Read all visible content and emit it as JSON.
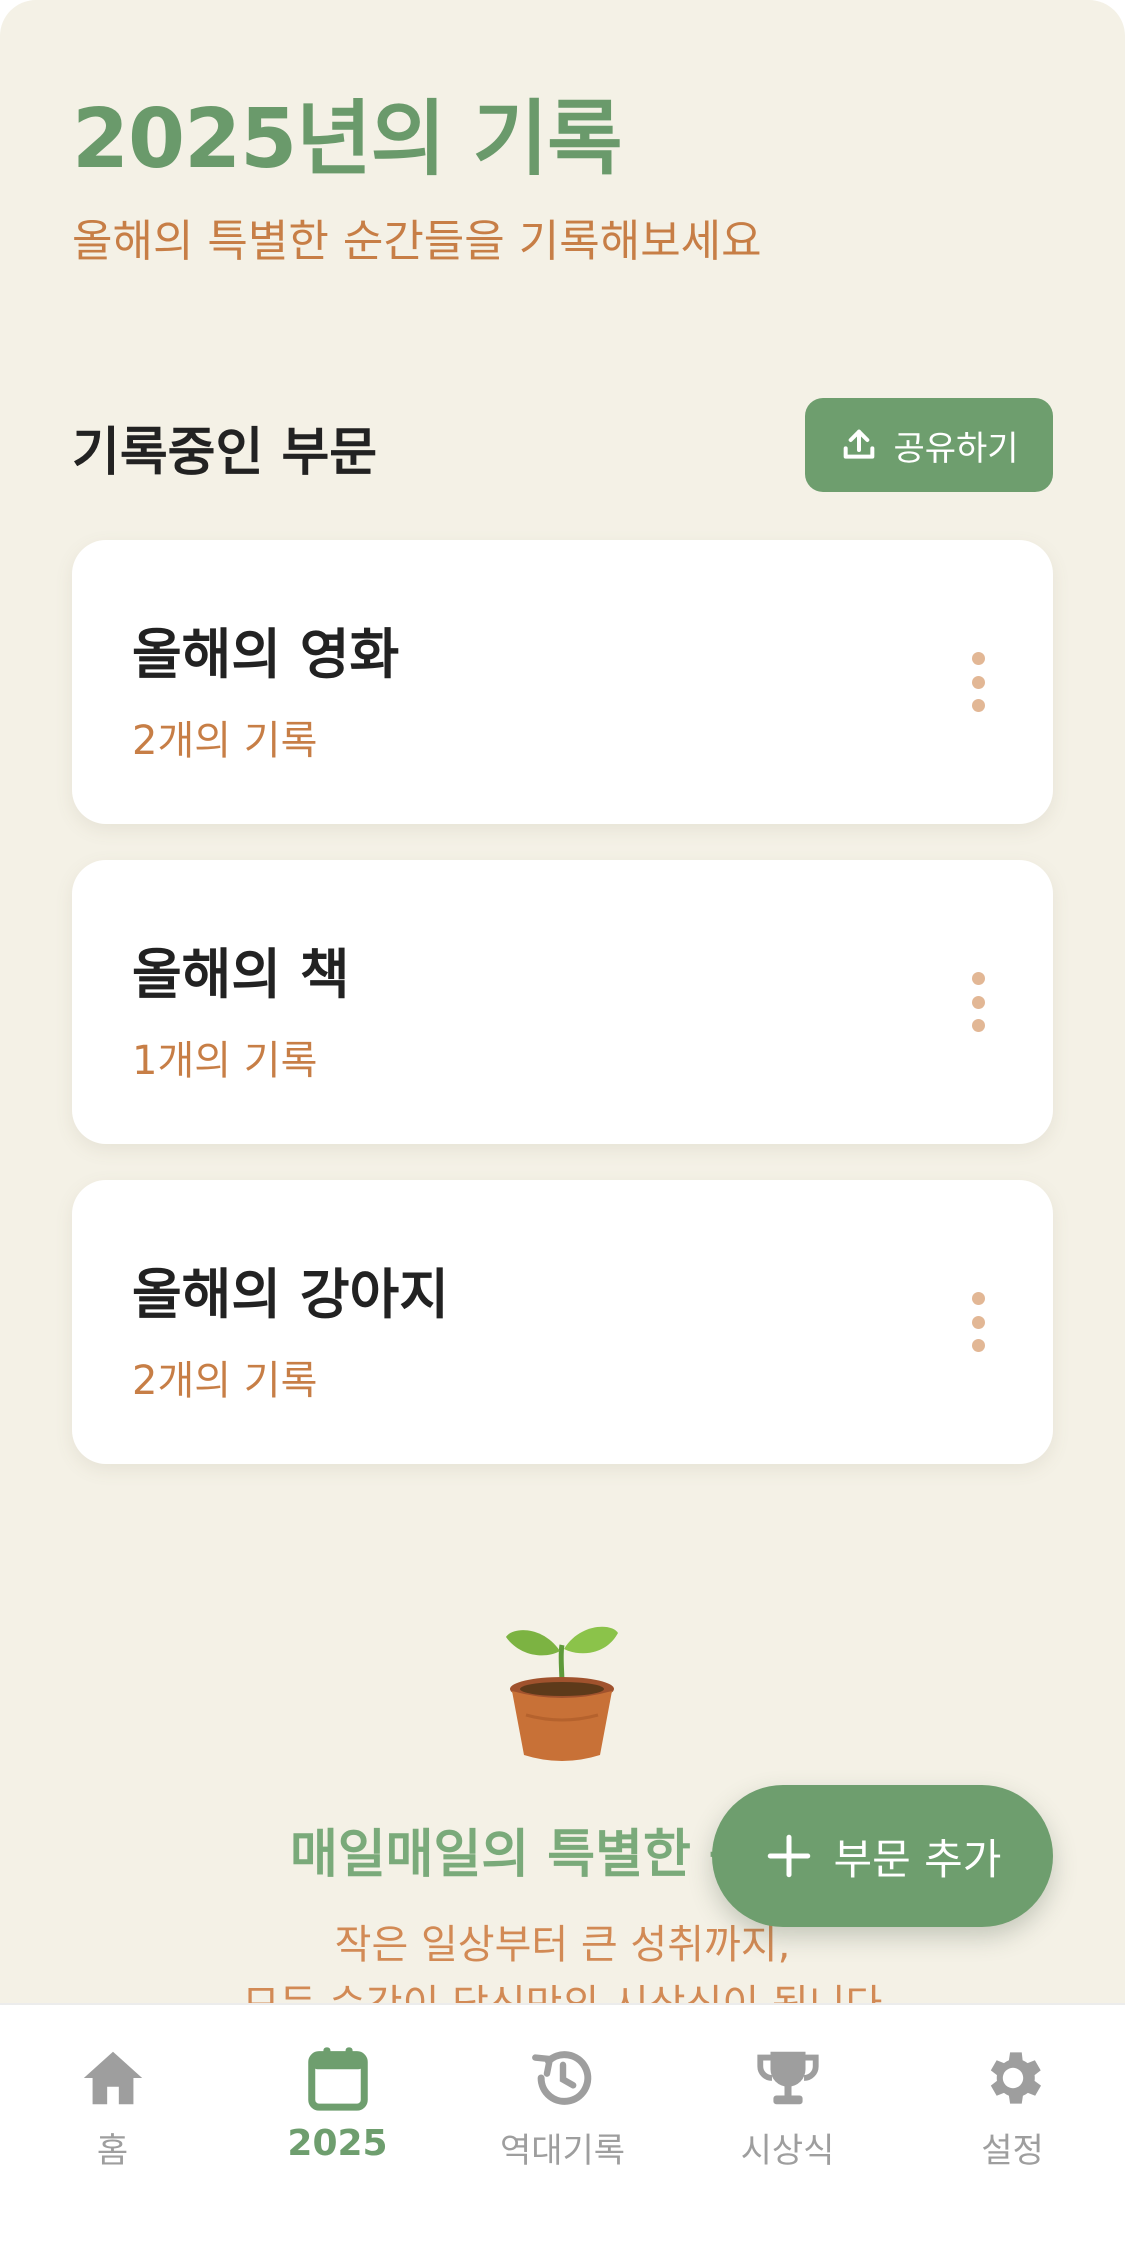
{
  "header": {
    "title": "2025년의 기록",
    "subtitle": "올해의 특별한 순간들을 기록해보세요"
  },
  "section": {
    "title": "기록중인 부문",
    "share_label": "공유하기"
  },
  "cards": [
    {
      "title": "올해의 영화",
      "count": "2개의 기록"
    },
    {
      "title": "올해의 책",
      "count": "1개의 기록"
    },
    {
      "title": "올해의 강아지",
      "count": "2개의 기록"
    }
  ],
  "promo": {
    "heading": "매일매일의 특별한 순",
    "line1": "작은 일상부터 큰 성취까지,",
    "line2": "모든 순간이 당신만의 시상식이 됩니다"
  },
  "fab": {
    "label": "부문 추가"
  },
  "nav": [
    {
      "label": "홈",
      "icon": "home-icon"
    },
    {
      "label": "2025",
      "icon": "calendar-icon",
      "active": true
    },
    {
      "label": "역대기록",
      "icon": "history-icon"
    },
    {
      "label": "시상식",
      "icon": "trophy-icon"
    },
    {
      "label": "설정",
      "icon": "gear-icon"
    }
  ],
  "colors": {
    "background": "#F4F1E6",
    "primary": "#6E9E6E",
    "accent": "#C77E46",
    "nav_inactive": "#9E9E9E"
  }
}
